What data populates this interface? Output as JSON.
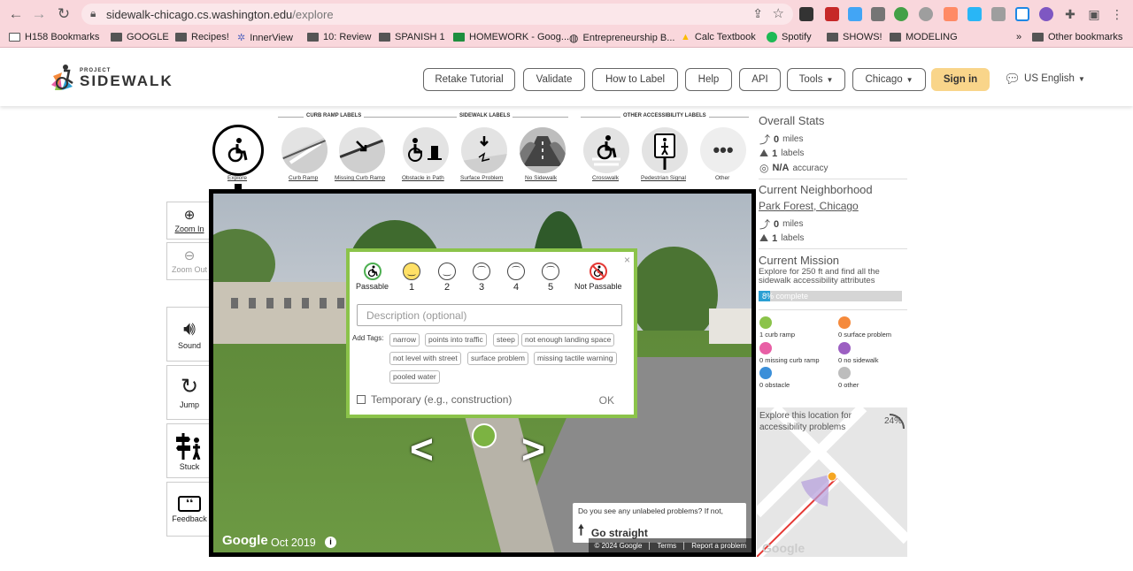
{
  "browser": {
    "url_host": "sidewalk-chicago.cs.washington.edu",
    "url_path": "/explore",
    "bookmarks": [
      "H158 Bookmarks",
      "GOOGLE",
      "Recipes!",
      "InnerView",
      "10: Review",
      "SPANISH 1",
      "HOMEWORK - Goog...",
      "Entrepreneurship B...",
      "Calc Textbook",
      "Spotify",
      "SHOWS!",
      "MODELING"
    ],
    "other_bookmarks": "Other bookmarks",
    "overflow": "»"
  },
  "header": {
    "logo_small": "PROJECT",
    "logo_big": "SIDEWALK",
    "nav": [
      "Retake Tutorial",
      "Validate",
      "How to Label",
      "Help",
      "API"
    ],
    "tools": "Tools",
    "city": "Chicago",
    "signin": "Sign in",
    "language": "US English"
  },
  "toolbar": {
    "groups": [
      "CURB RAMP LABELS",
      "SIDEWALK LABELS",
      "OTHER ACCESSIBILITY LABELS"
    ],
    "tools": [
      "Explore",
      "Curb Ramp",
      "Missing Curb Ramp",
      "Obstacle in Path",
      "Surface Problem",
      "No Sidewalk",
      "Crosswalk",
      "Pedestrian Signal",
      "Other"
    ]
  },
  "side_buttons": {
    "zoom_in": "Zoom In",
    "zoom_out": "Zoom Out",
    "sound": "Sound",
    "jump": "Jump",
    "stuck": "Stuck",
    "feedback": "Feedback"
  },
  "streetview": {
    "google": "Google",
    "date": "Oct 2019",
    "copyright": "© 2024 Google",
    "terms": "Terms",
    "report": "Report a problem",
    "hint": "Do you see any unlabeled problems? If not,",
    "hint_action": "Go straight"
  },
  "popup": {
    "close": "×",
    "severity": {
      "passable": "Passable",
      "levels": [
        "1",
        "2",
        "3",
        "4",
        "5"
      ],
      "not_passable": "Not Passable"
    },
    "description_placeholder": "Description (optional)",
    "add_tags": "Add Tags:",
    "tags": [
      "narrow",
      "points into traffic",
      "steep",
      "not enough landing space",
      "not level with street",
      "surface problem",
      "missing tactile warning",
      "pooled water"
    ],
    "temporary": "Temporary (e.g., construction)",
    "ok": "OK"
  },
  "stats": {
    "overall_title": "Overall Stats",
    "overall_miles": "0",
    "miles_unit": "miles",
    "overall_labels": "1",
    "labels_unit": "labels",
    "accuracy": "N/A",
    "accuracy_unit": "accuracy",
    "neighborhood_title": "Current Neighborhood",
    "neighborhood_name": "Park Forest, Chicago",
    "nb_miles": "0",
    "nb_labels": "1",
    "mission_title": "Current Mission",
    "mission_text": "Explore for 250 ft and find all the sidewalk accessibility attributes",
    "mission_progress": "8% complete",
    "counts": [
      {
        "text": "1 curb ramp",
        "color": "#8bc34a"
      },
      {
        "text": "0 surface problem",
        "color": "#f58a3c"
      },
      {
        "text": "0 missing curb ramp",
        "color": "#e85fa5"
      },
      {
        "text": "0 no sidewalk",
        "color": "#9c5fc2"
      },
      {
        "text": "0 obstacle",
        "color": "#3b8fd9"
      },
      {
        "text": "0 other",
        "color": "#bdbdbd"
      }
    ],
    "minimap_caption": "Explore this location for accessibility problems",
    "minimap_pct": "24%",
    "minimap_google": "Google"
  }
}
